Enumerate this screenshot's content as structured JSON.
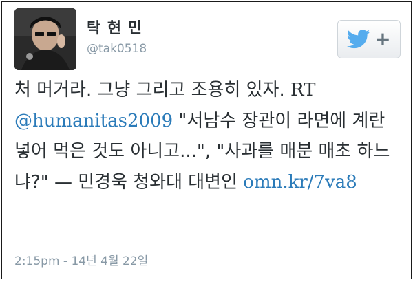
{
  "user": {
    "display_name": "탁 현 민",
    "handle": "@tak0518"
  },
  "tweet": {
    "segment_1": "처 머거라. 그냥 그리고 조용히 있자. ",
    "rt": "RT",
    "mention": "@humanitas2009",
    "segment_2": " \"서남수 장관이 라면에 계란 넣어 먹은 것도 아니고...\", \"사과를 매분 매초 하느냐?\" — 민경욱 청와대 대변인 ",
    "link": "omn.kr/7va8"
  },
  "timestamp": "2:15pm - 14년 4월 22일",
  "icons": {
    "follow_button_icon": "twitter-bird-icon",
    "follow_plus_icon": "plus-icon"
  },
  "colors": {
    "link": "#2b7bb9",
    "twitter_blue": "#55acee",
    "muted": "#8899a6",
    "text": "#292f33"
  }
}
